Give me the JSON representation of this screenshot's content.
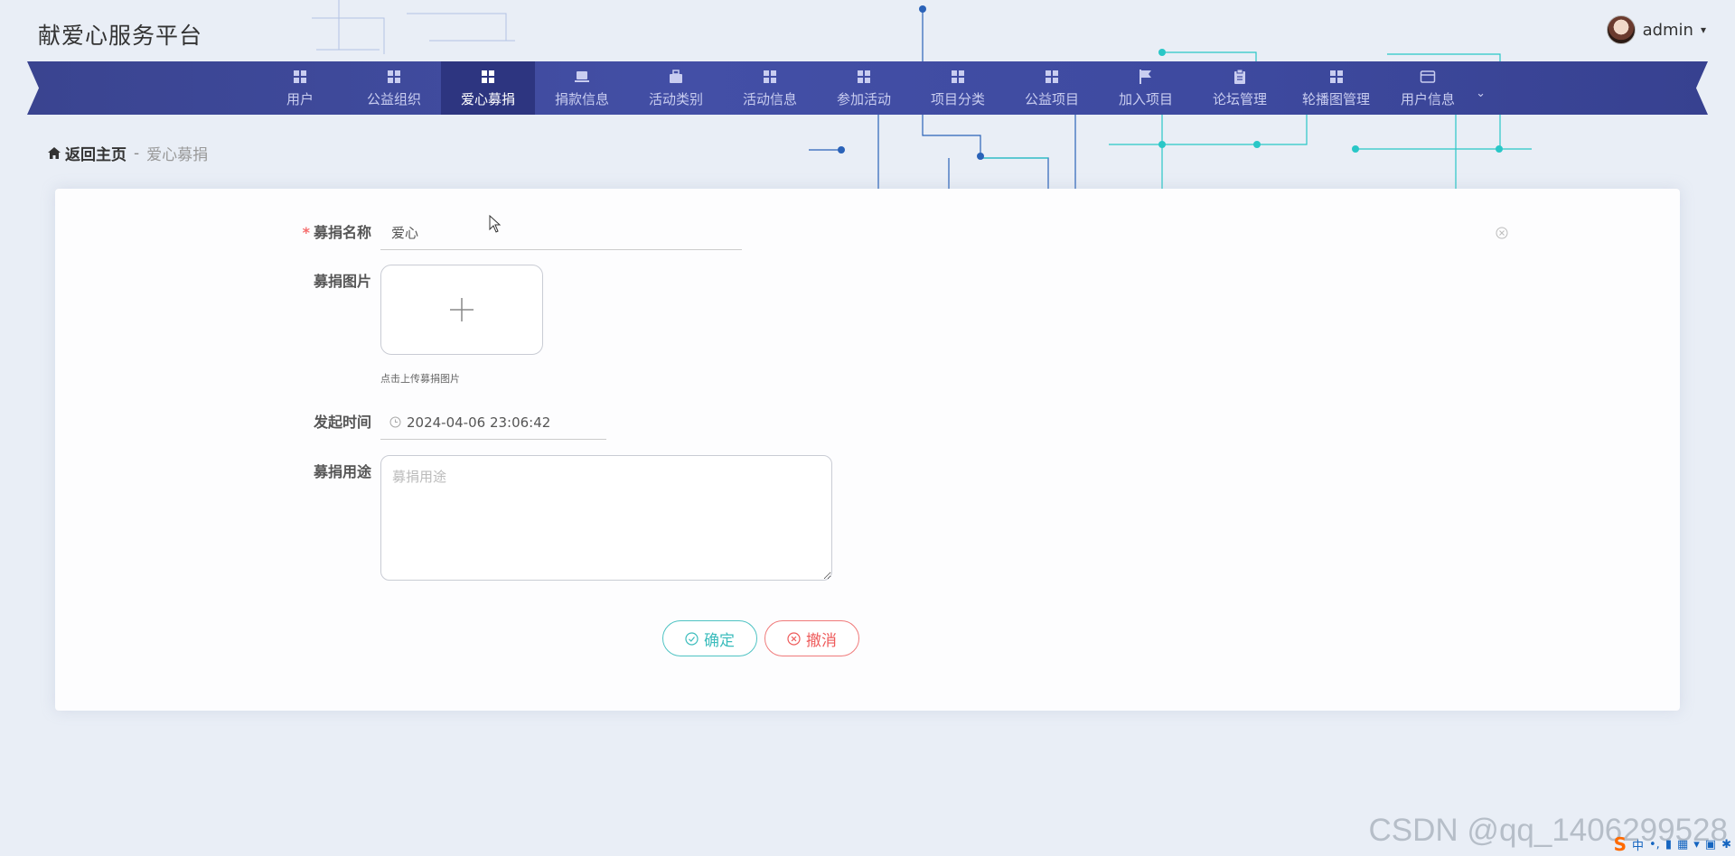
{
  "header": {
    "site_title": "献爱心服务平台",
    "username": "admin",
    "username_caret": "▾"
  },
  "nav": {
    "items": [
      {
        "label": "用户",
        "icon": "grid-icon"
      },
      {
        "label": "公益组织",
        "icon": "grid-icon"
      },
      {
        "label": "爱心募捐",
        "icon": "grid-icon",
        "active": true
      },
      {
        "label": "捐款信息",
        "icon": "laptop-icon"
      },
      {
        "label": "活动类别",
        "icon": "briefcase-icon"
      },
      {
        "label": "活动信息",
        "icon": "grid-icon"
      },
      {
        "label": "参加活动",
        "icon": "grid-icon"
      },
      {
        "label": "项目分类",
        "icon": "grid-icon"
      },
      {
        "label": "公益项目",
        "icon": "grid-icon"
      },
      {
        "label": "加入项目",
        "icon": "flag-icon"
      },
      {
        "label": "论坛管理",
        "icon": "clipboard-icon"
      },
      {
        "label": "轮播图管理",
        "icon": "grid-icon"
      },
      {
        "label": "用户信息",
        "icon": "card-icon",
        "dropdown": true
      }
    ],
    "dropdown_arrow": "⌄"
  },
  "breadcrumb": {
    "home_label": "返回主页",
    "separator": "-",
    "current": "爱心募捐"
  },
  "form": {
    "required_mark": "*",
    "name_label": "募捐名称",
    "name_value": "爱心",
    "image_label": "募捐图片",
    "upload_tip": "点击上传募捐图片",
    "time_label": "发起时间",
    "time_value": "2024-04-06 23:06:42",
    "purpose_label": "募捐用途",
    "purpose_placeholder": "募捐用途",
    "confirm_label": "确定",
    "cancel_label": "撤消"
  },
  "watermark": "CSDN @qq_1406299528",
  "tray": {
    "ime_logo": "S",
    "ime_lang": "中"
  },
  "colors": {
    "nav_bg": "#434fa6",
    "nav_active": "#2d3580",
    "confirm": "#3bbcbc",
    "cancel": "#ee5a5a",
    "required": "#f56c6c"
  }
}
